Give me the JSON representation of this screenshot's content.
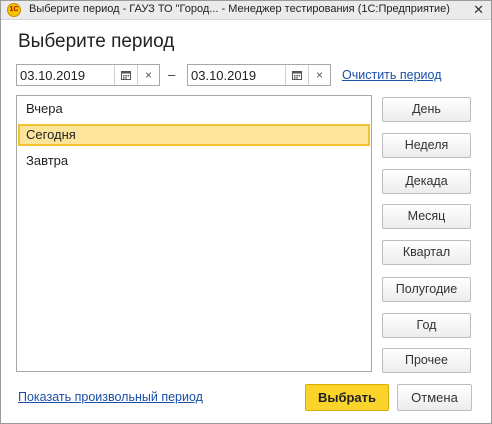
{
  "window": {
    "title": "Выберите период - ГАУЗ ТО \"Город... - Менеджер тестирования (1С:Предприятие)",
    "app_icon": "1C",
    "close_glyph": "✕"
  },
  "heading": "Выберите период",
  "date_from": {
    "value": "03.10.2019",
    "calendar_icon": "calendar-icon",
    "clear_glyph": "×"
  },
  "date_to": {
    "value": "03.10.2019",
    "calendar_icon": "calendar-icon",
    "clear_glyph": "×"
  },
  "range_separator": "–",
  "clear_link": "Очистить период",
  "periods": [
    {
      "label": "Вчера",
      "selected": false
    },
    {
      "label": "Сегодня",
      "selected": true
    },
    {
      "label": "Завтра",
      "selected": false
    }
  ],
  "period_buttons": [
    "День",
    "Неделя",
    "Декада",
    "Месяц",
    "Квартал",
    "Полугодие",
    "Год",
    "Прочее"
  ],
  "show_custom_link": "Показать произвольный период",
  "ok_button": "Выбрать",
  "cancel_button": "Отмена",
  "colors": {
    "selection_bg": "#fce59a",
    "selection_border": "#f2c22f",
    "primary_button": "#fbd42b",
    "link": "#1a4fa8"
  }
}
